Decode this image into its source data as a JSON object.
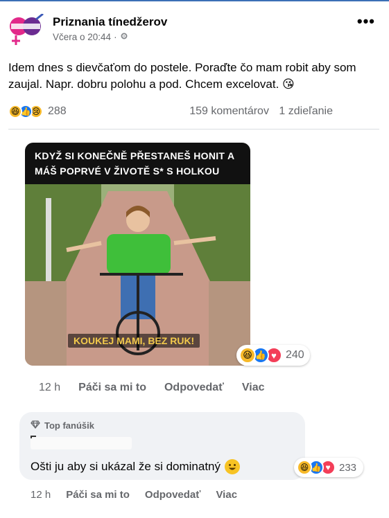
{
  "post": {
    "page_name": "Priznania tínedžerov",
    "timestamp": "Včera o 20:44",
    "meta_separator": "·",
    "privacy_icon": "gear-icon",
    "more_icon": "ellipsis-icon",
    "more_label": "•••",
    "text": "Idem dnes s dievčaťom do postele. Poraďte čo mam robit aby som zaujal. Napr. dobru polohu a pod. Chcem excelovat. 😘",
    "reactions": [
      "haha",
      "like",
      "sad"
    ],
    "reaction_count": "288",
    "comments": "159 komentárov",
    "shares": "1 zdieľanie"
  },
  "comment": {
    "meme_top_text": "Když si konečně přestaneš honit a máš poprvé v životě s* s holkou",
    "meme_bottom_text": "Koukej mami, bez ruk!",
    "reactions": [
      "haha",
      "like",
      "love"
    ],
    "reaction_count": "240",
    "time": "12 h",
    "like_label": "Páči sa mi to",
    "reply_label": "Odpovedať",
    "more_label": "Viac"
  },
  "reply": {
    "badge_icon": "diamond-icon",
    "badge_label": "Top fanúšik",
    "text": "Ošti ju aby si ukázal že si dominatný",
    "emoji": "😃",
    "reactions": [
      "haha",
      "like",
      "love"
    ],
    "reaction_count": "233",
    "time": "12 h",
    "like_label": "Páči sa mi to",
    "reply_label": "Odpovedať",
    "more_label": "Viac"
  },
  "colors": {
    "accent_blue": "#1877f2",
    "secondary_text": "#65676b",
    "bubble_bg": "#f0f2f5",
    "haha_yellow": "#f7b928",
    "love_red": "#f33e58"
  }
}
